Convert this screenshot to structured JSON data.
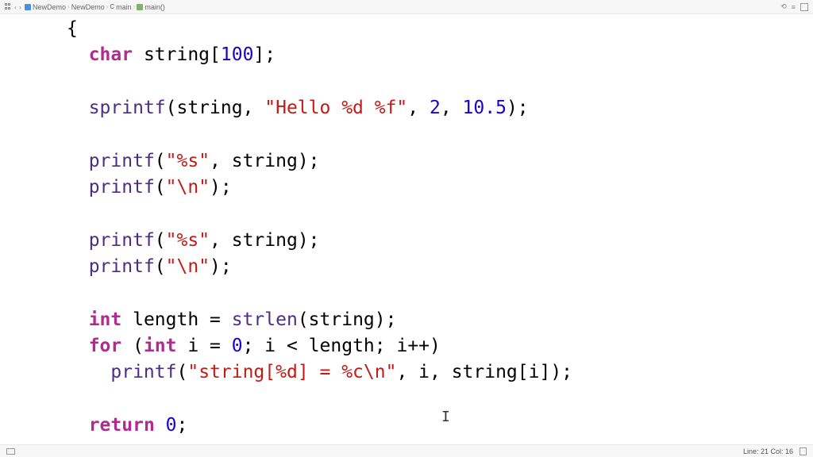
{
  "breadcrumb": {
    "items": [
      {
        "label": "NewDemo"
      },
      {
        "label": "NewDemo"
      },
      {
        "label": "main"
      },
      {
        "label": "main()"
      }
    ]
  },
  "code": {
    "l1": "{",
    "l2_kw": "char",
    "l2_rest_a": " string[",
    "l2_num": "100",
    "l2_rest_b": "];",
    "l3_func": "sprintf",
    "l3_a": "(string, ",
    "l3_str": "\"Hello %d %f\"",
    "l3_b": ", ",
    "l3_num1": "2",
    "l3_c": ", ",
    "l3_num2": "10.5",
    "l3_d": ");",
    "l4_func": "printf",
    "l4_a": "(",
    "l4_str": "\"%s\"",
    "l4_b": ", string);",
    "l5_func": "printf",
    "l5_a": "(",
    "l5_str": "\"\\n\"",
    "l5_b": ");",
    "l6_func": "printf",
    "l6_a": "(",
    "l6_str": "\"%s\"",
    "l6_b": ", string);",
    "l7_func": "printf",
    "l7_a": "(",
    "l7_str": "\"\\n\"",
    "l7_b": ");",
    "l8_kw": "int",
    "l8_a": " length = ",
    "l8_func": "strlen",
    "l8_b": "(string);",
    "l9_kw1": "for",
    "l9_a": " (",
    "l9_kw2": "int",
    "l9_b": " i = ",
    "l9_num": "0",
    "l9_c": "; i < length; i++)",
    "l10_func": "printf",
    "l10_a": "(",
    "l10_str": "\"string[%d] = %c\\n\"",
    "l10_b": ", i, string[i]);",
    "l11_kw": "return",
    "l11_a": " ",
    "l11_num": "0",
    "l11_b": ";"
  },
  "status": {
    "line_col": "Line: 21 Col: 16"
  }
}
